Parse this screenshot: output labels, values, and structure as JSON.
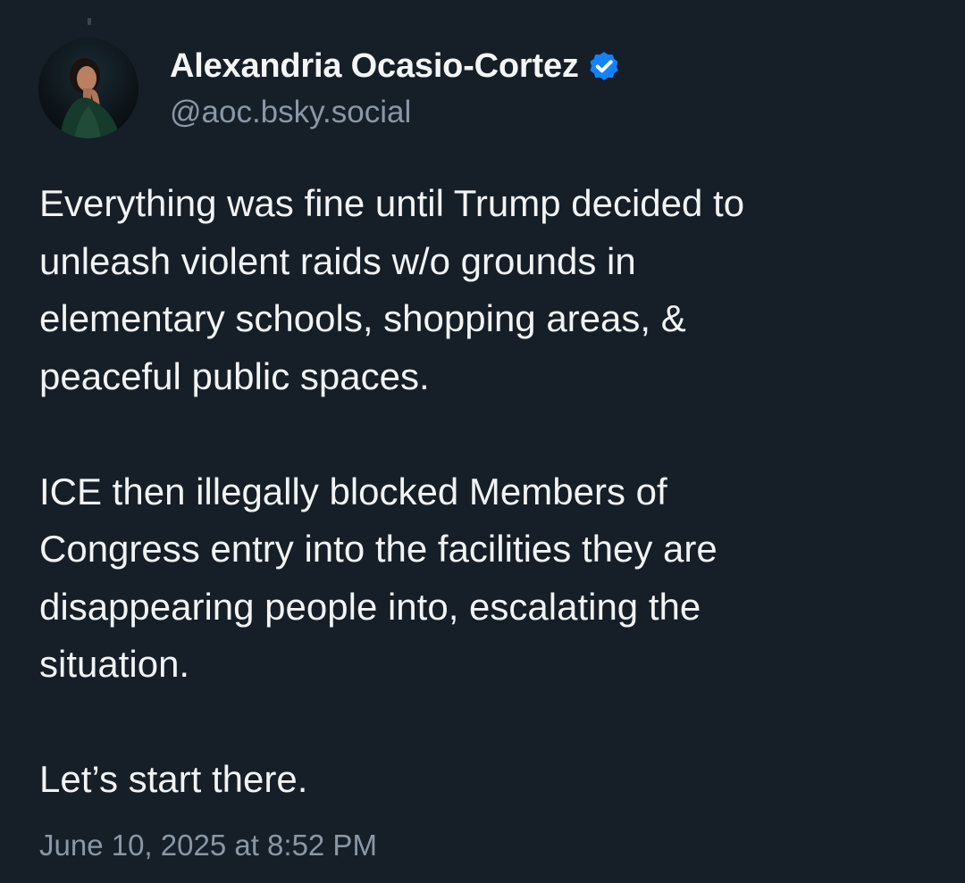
{
  "author": {
    "display_name": "Alexandria Ocasio-Cortez",
    "handle": "@aoc.bsky.social",
    "verified": true,
    "avatar_icon": "profile-photo",
    "verified_icon": "verified-checkmark-icon"
  },
  "post": {
    "paragraphs": [
      {
        "lines": [
          "Everything was fine until Trump decided to",
          "unleash violent raids w/o grounds in",
          "elementary schools, shopping areas, &",
          "peaceful public spaces."
        ]
      },
      {
        "lines": [
          "ICE then illegally blocked Members of",
          "Congress entry into the facilities they are",
          "disappearing people into, escalating the",
          "situation."
        ]
      },
      {
        "lines": [
          "Let’s start there."
        ]
      }
    ],
    "timestamp": "June 10, 2025 at 8:52 PM"
  },
  "colors": {
    "background": "#161e27",
    "primary_text": "#f1f3f5",
    "secondary_text": "#8a97a6",
    "verified_badge": "#1083fe"
  }
}
